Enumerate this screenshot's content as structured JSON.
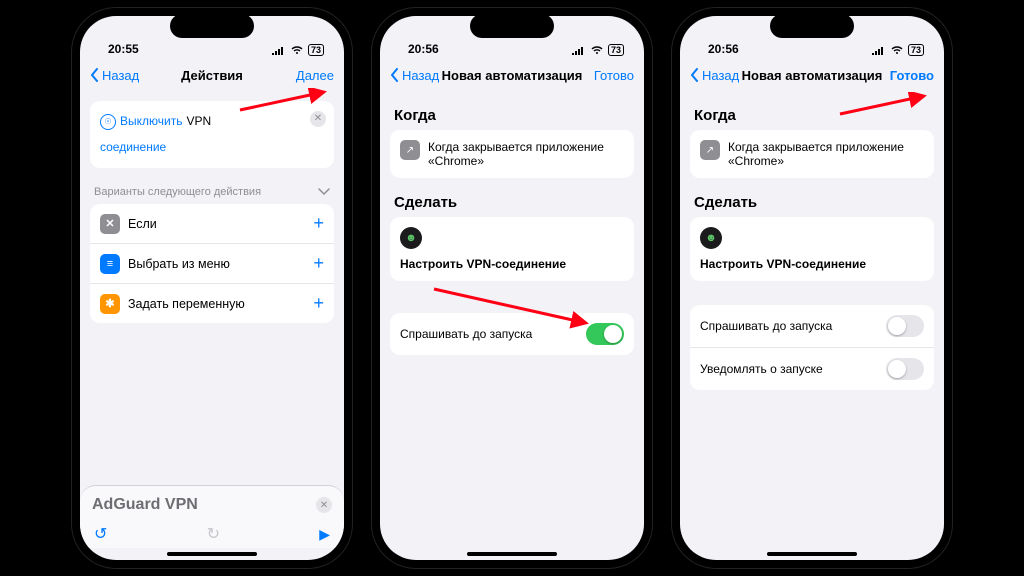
{
  "colors": {
    "ios_blue": "#007aff",
    "ios_green": "#34c759"
  },
  "phones": [
    {
      "status": {
        "time": "20:55",
        "battery": "73"
      },
      "nav": {
        "back": "Назад",
        "title": "Действия",
        "done": "Далее"
      },
      "action": {
        "token1": "Выключить",
        "token2": "VPN",
        "token3": "соединение"
      },
      "suggest_header": "Варианты следующего действия",
      "rows": [
        {
          "label": "Если",
          "iconBg": "#8e8e93",
          "glyph": "✕"
        },
        {
          "label": "Выбрать из меню",
          "iconBg": "#007aff",
          "glyph": "≡"
        },
        {
          "label": "Задать переменную",
          "iconBg": "#ff9500",
          "glyph": "✱"
        }
      ],
      "search": "AdGuard VPN"
    },
    {
      "status": {
        "time": "20:56",
        "battery": "73"
      },
      "nav": {
        "back": "Назад",
        "title": "Новая автоматизация",
        "done": "Готово"
      },
      "when_header": "Когда",
      "when_text": "Когда закрывается приложение «Chrome»",
      "do_header": "Сделать",
      "do_text": "Настроить VPN-соединение",
      "toggle_label": "Спрашивать до запуска",
      "toggle_on": true
    },
    {
      "status": {
        "time": "20:56",
        "battery": "73"
      },
      "nav": {
        "back": "Назад",
        "title": "Новая автоматизация",
        "done": "Готово"
      },
      "when_header": "Когда",
      "when_text": "Когда закрывается приложение «Chrome»",
      "do_header": "Сделать",
      "do_text": "Настроить VPN-соединение",
      "toggles": [
        {
          "label": "Спрашивать до запуска",
          "on": false
        },
        {
          "label": "Уведомлять о запуске",
          "on": false
        }
      ]
    }
  ]
}
